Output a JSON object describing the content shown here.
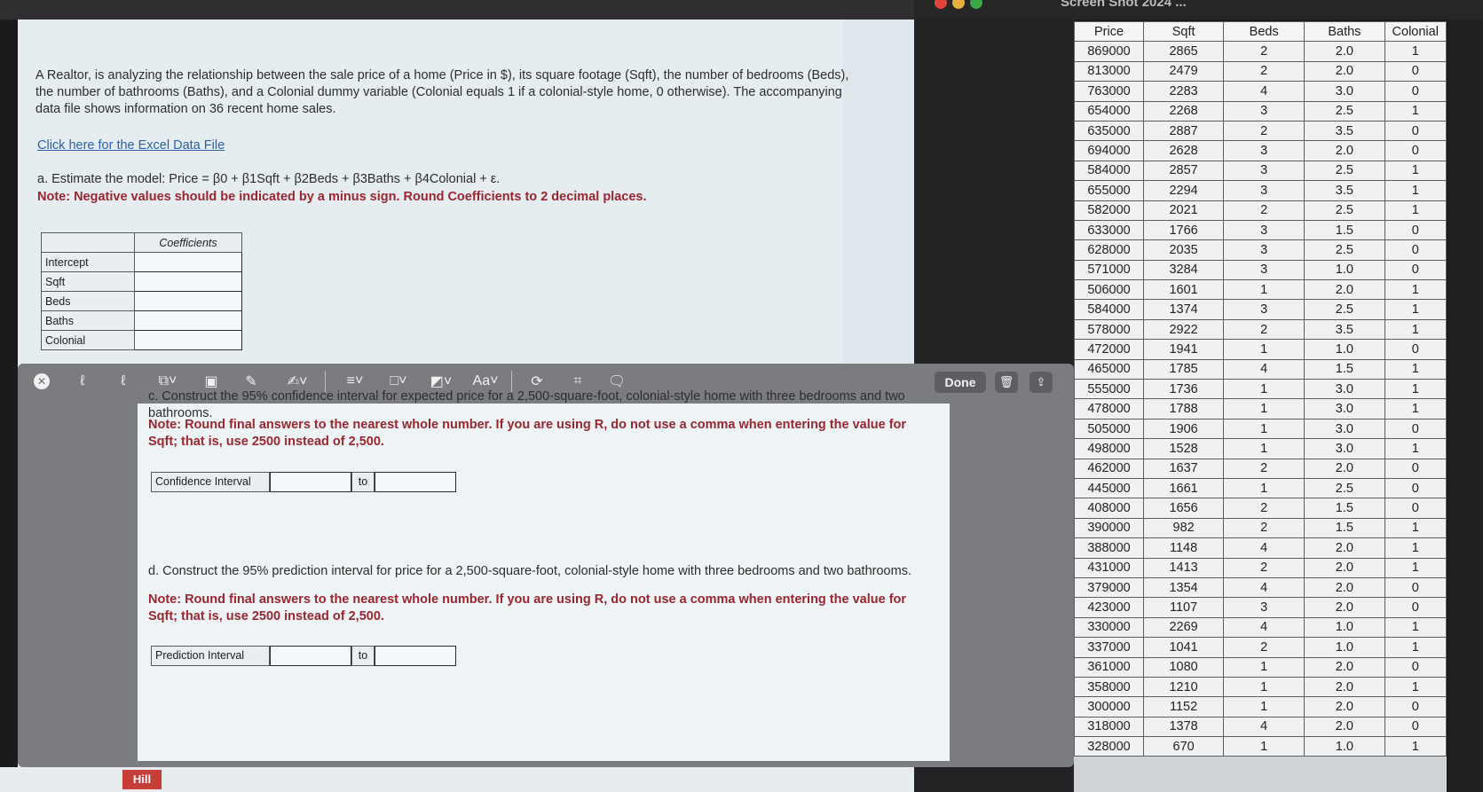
{
  "window": {
    "title": "Screen Shot 2024 ..."
  },
  "question": {
    "intro": "A Realtor, is analyzing the relationship between the sale price of a home (Price in $), its square footage (Sqft), the number of bedrooms (Beds), the number of bathrooms (Baths), and a Colonial dummy variable (Colonial equals 1 if a colonial-style home, 0 otherwise). The accompanying data file shows information on 36 recent home sales.",
    "excel_link": "Click here for the Excel Data File",
    "part_a": "a. Estimate the model: Price = β0 + β1Sqft + β2Beds + β3Baths + β4Colonial + ε.",
    "part_a_note": "Note: Negative values should be indicated by a minus sign. Round Coefficients to 2 decimal places.",
    "coef_header": "Coefficients",
    "coef_rows": [
      "Intercept",
      "Sqft",
      "Beds",
      "Baths",
      "Colonial"
    ],
    "part_c": "c. Construct the 95% confidence interval for expected price for a 2,500-square-foot, colonial-style home with three bedrooms and two bathrooms.",
    "part_c_note": "Note: Round final answers to the nearest whole number. If you are using R, do not use a comma when entering the value for Sqft; that is, use 2500 instead of 2,500.",
    "ci_label": "Confidence Interval",
    "to_label": "to",
    "part_d": "d. Construct the 95% prediction interval for price for a 2,500-square-foot, colonial-style home with three bedrooms and two bathrooms.",
    "part_d_note": "Note: Round final answers to the nearest whole number. If you are using R, do not use a comma when entering the value for Sqft; that is, use 2500 instead of 2,500.",
    "pi_label": "Prediction Interval",
    "brand": "Hill"
  },
  "toolbar": {
    "done": "Done",
    "font_label": "Aa"
  },
  "data_table": {
    "headers": [
      "Price",
      "Sqft",
      "Beds",
      "Baths",
      "Colonial"
    ],
    "rows": [
      [
        "869000",
        "2865",
        "2",
        "2.0",
        "1"
      ],
      [
        "813000",
        "2479",
        "2",
        "2.0",
        "0"
      ],
      [
        "763000",
        "2283",
        "4",
        "3.0",
        "0"
      ],
      [
        "654000",
        "2268",
        "3",
        "2.5",
        "1"
      ],
      [
        "635000",
        "2887",
        "2",
        "3.5",
        "0"
      ],
      [
        "694000",
        "2628",
        "3",
        "2.0",
        "0"
      ],
      [
        "584000",
        "2857",
        "3",
        "2.5",
        "1"
      ],
      [
        "655000",
        "2294",
        "3",
        "3.5",
        "1"
      ],
      [
        "582000",
        "2021",
        "2",
        "2.5",
        "1"
      ],
      [
        "633000",
        "1766",
        "3",
        "1.5",
        "0"
      ],
      [
        "628000",
        "2035",
        "3",
        "2.5",
        "0"
      ],
      [
        "571000",
        "3284",
        "3",
        "1.0",
        "0"
      ],
      [
        "506000",
        "1601",
        "1",
        "2.0",
        "1"
      ],
      [
        "584000",
        "1374",
        "3",
        "2.5",
        "1"
      ],
      [
        "578000",
        "2922",
        "2",
        "3.5",
        "1"
      ],
      [
        "472000",
        "1941",
        "1",
        "1.0",
        "0"
      ],
      [
        "465000",
        "1785",
        "4",
        "1.5",
        "1"
      ],
      [
        "555000",
        "1736",
        "1",
        "3.0",
        "1"
      ],
      [
        "478000",
        "1788",
        "1",
        "3.0",
        "1"
      ],
      [
        "505000",
        "1906",
        "1",
        "3.0",
        "0"
      ],
      [
        "498000",
        "1528",
        "1",
        "3.0",
        "1"
      ],
      [
        "462000",
        "1637",
        "2",
        "2.0",
        "0"
      ],
      [
        "445000",
        "1661",
        "1",
        "2.5",
        "0"
      ],
      [
        "408000",
        "1656",
        "2",
        "1.5",
        "0"
      ],
      [
        "390000",
        "982",
        "2",
        "1.5",
        "1"
      ],
      [
        "388000",
        "1148",
        "4",
        "2.0",
        "1"
      ],
      [
        "431000",
        "1413",
        "2",
        "2.0",
        "1"
      ],
      [
        "379000",
        "1354",
        "4",
        "2.0",
        "0"
      ],
      [
        "423000",
        "1107",
        "3",
        "2.0",
        "0"
      ],
      [
        "330000",
        "2269",
        "4",
        "1.0",
        "1"
      ],
      [
        "337000",
        "1041",
        "2",
        "1.0",
        "1"
      ],
      [
        "361000",
        "1080",
        "1",
        "2.0",
        "0"
      ],
      [
        "358000",
        "1210",
        "1",
        "2.0",
        "1"
      ],
      [
        "300000",
        "1152",
        "1",
        "2.0",
        "0"
      ],
      [
        "318000",
        "1378",
        "4",
        "2.0",
        "0"
      ],
      [
        "328000",
        "670",
        "1",
        "1.0",
        "1"
      ]
    ]
  }
}
